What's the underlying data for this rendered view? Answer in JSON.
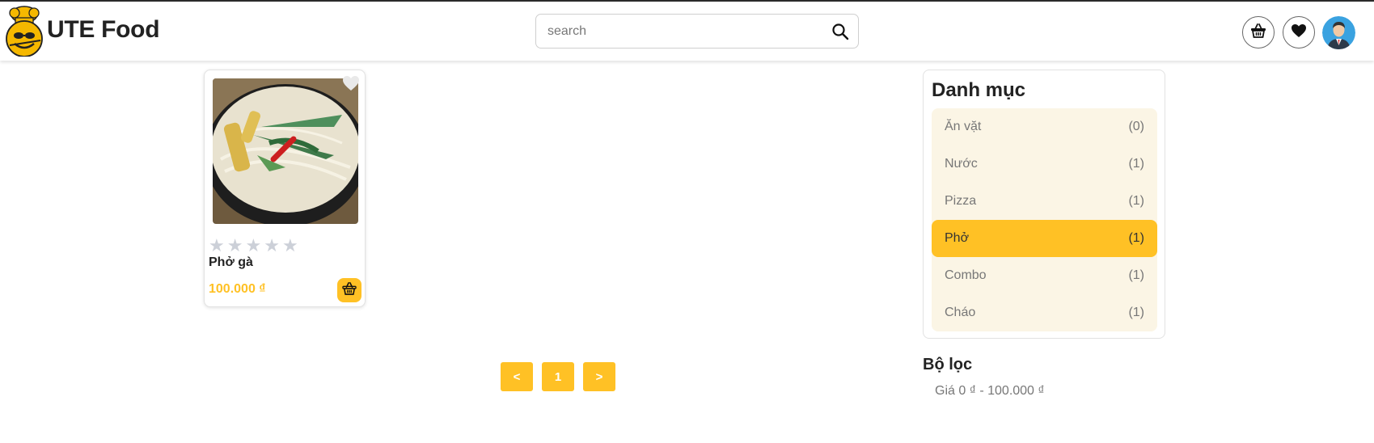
{
  "header": {
    "brand": "UTE Food",
    "search_placeholder": "search"
  },
  "product": {
    "name": "Phở gà",
    "price": "100.000 ₫",
    "rating": 0,
    "rating_max": 5
  },
  "pagination": {
    "prev": "<",
    "current": "1",
    "next": ">"
  },
  "categories": {
    "title": "Danh mục",
    "items": [
      {
        "label": "Ăn vặt",
        "count": "(0)",
        "active": false
      },
      {
        "label": "Nước",
        "count": "(1)",
        "active": false
      },
      {
        "label": "Pizza",
        "count": "(1)",
        "active": false
      },
      {
        "label": "Phở",
        "count": "(1)",
        "active": true
      },
      {
        "label": "Combo",
        "count": "(1)",
        "active": false
      },
      {
        "label": "Cháo",
        "count": "(1)",
        "active": false
      }
    ]
  },
  "filter": {
    "title": "Bộ lọc",
    "price_range": "Giá 0 ₫ - 100.000 ₫"
  },
  "colors": {
    "accent": "#ffc125",
    "category_bg": "#fbf5e5"
  },
  "icons": {
    "logo": "chef-logo-icon",
    "search": "search-icon",
    "cart": "basket-icon",
    "favorite": "heart-icon",
    "avatar": "user-avatar",
    "product_favorite": "heart-outline-icon",
    "add_to_cart": "basket-icon",
    "rating": "star-icon"
  }
}
